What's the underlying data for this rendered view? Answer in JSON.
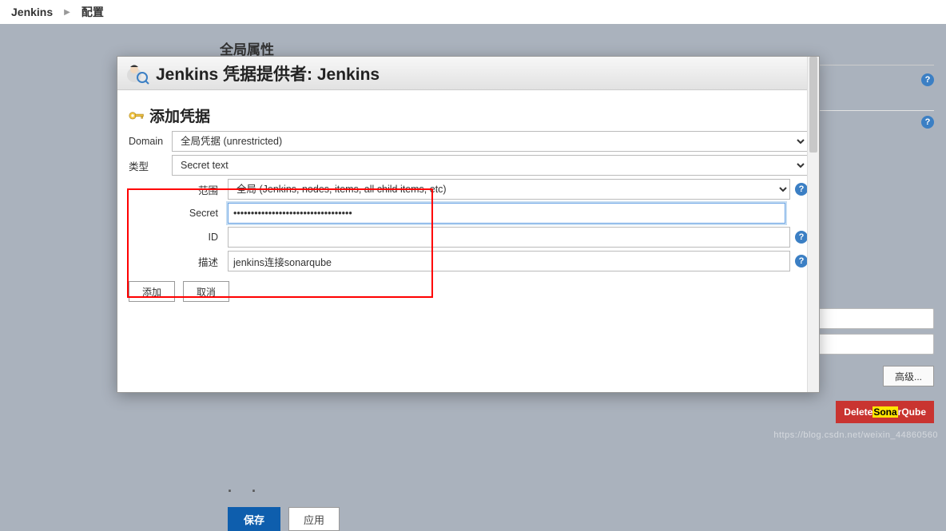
{
  "breadcrumb": {
    "root": "Jenkins",
    "page": "配置"
  },
  "bg": {
    "sectionTitle": "全局属性",
    "advanced": "高级...",
    "delete": {
      "pre": "Delete",
      "hl": "Sona",
      "post": "rQube"
    },
    "save": "保存",
    "apply": "应用"
  },
  "modal": {
    "title": "Jenkins 凭据提供者: Jenkins",
    "sectionTitle": "添加凭据",
    "domainLabel": "Domain",
    "domainValue": "全局凭据 (unrestricted)",
    "typeLabel": "类型",
    "typeValue": "Secret text",
    "scopeLabel": "范围",
    "scopeValue": "全局 (Jenkins, nodes, items, all child items, etc)",
    "secretLabel": "Secret",
    "secretValue": "••••••••••••••••••••••••••••••••••",
    "idLabel": "ID",
    "idValue": "",
    "descLabel": "描述",
    "descValue": "jenkins连接sonarqube",
    "addBtn": "添加",
    "cancelBtn": "取消"
  },
  "watermark": "https://blog.csdn.net/weixin_44860560"
}
